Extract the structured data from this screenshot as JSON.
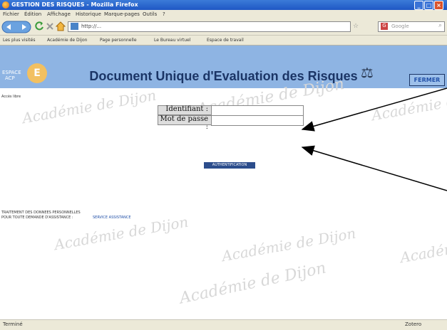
{
  "window": {
    "title": "GESTION DES RISQUES - Mozilla Firefox"
  },
  "menu": [
    "Fichier",
    "Édition",
    "Affichage",
    "Historique",
    "Marque-pages",
    "Outils",
    "?"
  ],
  "nav": {
    "url": "http://...",
    "search_placeholder": "Google"
  },
  "bookmarks": [
    "Les plus visités",
    "Académie de Dijon",
    "Page personnelle",
    "Le Bureau virtuel",
    "Espace de travail"
  ],
  "banner": {
    "logo_text_1": "ESPACE",
    "logo_text_2": "ACP",
    "logo_letter": "E",
    "title": "Document Unique d'Evaluation des Risques",
    "close_label": "FERMER"
  },
  "content": {
    "user_status": "Accès libre",
    "watermark": "Académie de Dijon",
    "login": {
      "id_label": "Identifiant :",
      "password_label": "Mot de passe :",
      "id_value": "",
      "password_value": ""
    },
    "auth_button": "AUTHENTIFICATION",
    "footer_line_1": "TRAITEMENT DES DONNEES PERSONNELLES",
    "footer_line_2": "POUR TOUTE DEMANDE D'ASSISTANCE :",
    "footer_link": "SERVICE ASSISTANCE"
  },
  "status": {
    "left": "Terminé",
    "right": "Zotero"
  }
}
